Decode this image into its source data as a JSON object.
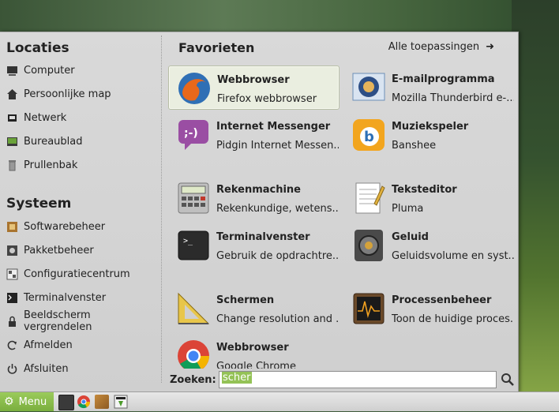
{
  "left": {
    "locations_title": "Locaties",
    "locations": [
      {
        "label": "Computer",
        "icon": "computer-icon"
      },
      {
        "label": "Persoonlijke map",
        "icon": "home-icon"
      },
      {
        "label": "Netwerk",
        "icon": "network-icon"
      },
      {
        "label": "Bureaublad",
        "icon": "desktop-icon"
      },
      {
        "label": "Prullenbak",
        "icon": "trash-icon"
      }
    ],
    "system_title": "Systeem",
    "system": [
      {
        "label": "Softwarebeheer",
        "icon": "software-manager-icon"
      },
      {
        "label": "Pakketbeheer",
        "icon": "package-manager-icon"
      },
      {
        "label": "Configuratiecentrum",
        "icon": "control-center-icon"
      },
      {
        "label": "Terminalvenster",
        "icon": "terminal-icon"
      },
      {
        "label": "Beeldscherm vergrendelen",
        "icon": "lock-icon"
      },
      {
        "label": "Afmelden",
        "icon": "logout-icon"
      },
      {
        "label": "Afsluiten",
        "icon": "power-icon"
      }
    ]
  },
  "favorites": {
    "title": "Favorieten",
    "all_apps_label": "Alle toepassingen",
    "apps": [
      {
        "name": "Webbrowser",
        "desc": "Firefox webbrowser",
        "icon": "firefox-icon"
      },
      {
        "name": "E-mailprogramma",
        "desc": "Mozilla Thunderbird e-...",
        "icon": "thunderbird-icon"
      },
      {
        "name": "Internet Messenger",
        "desc": "Pidgin Internet Messen...",
        "icon": "pidgin-icon"
      },
      {
        "name": "Muziekspeler",
        "desc": "Banshee",
        "icon": "banshee-icon"
      },
      {
        "name": "Rekenmachine",
        "desc": "Rekenkundige, wetens...",
        "icon": "calculator-icon"
      },
      {
        "name": "Teksteditor",
        "desc": "Pluma",
        "icon": "text-editor-icon"
      },
      {
        "name": "Terminalvenster",
        "desc": "Gebruik de opdrachtre...",
        "icon": "terminal-icon"
      },
      {
        "name": "Geluid",
        "desc": "Geluidsvolume en syst...",
        "icon": "speaker-icon"
      },
      {
        "name": "Schermen",
        "desc": "Change resolution and ...",
        "icon": "display-settings-icon"
      },
      {
        "name": "Processenbeheer",
        "desc": "Toon de huidige proces...",
        "icon": "system-monitor-icon"
      },
      {
        "name": "Webbrowser",
        "desc": "Google Chrome",
        "icon": "chrome-icon"
      }
    ]
  },
  "search": {
    "label": "Zoeken:",
    "value": "scher"
  },
  "taskbar": {
    "menu_label": "Menu"
  }
}
